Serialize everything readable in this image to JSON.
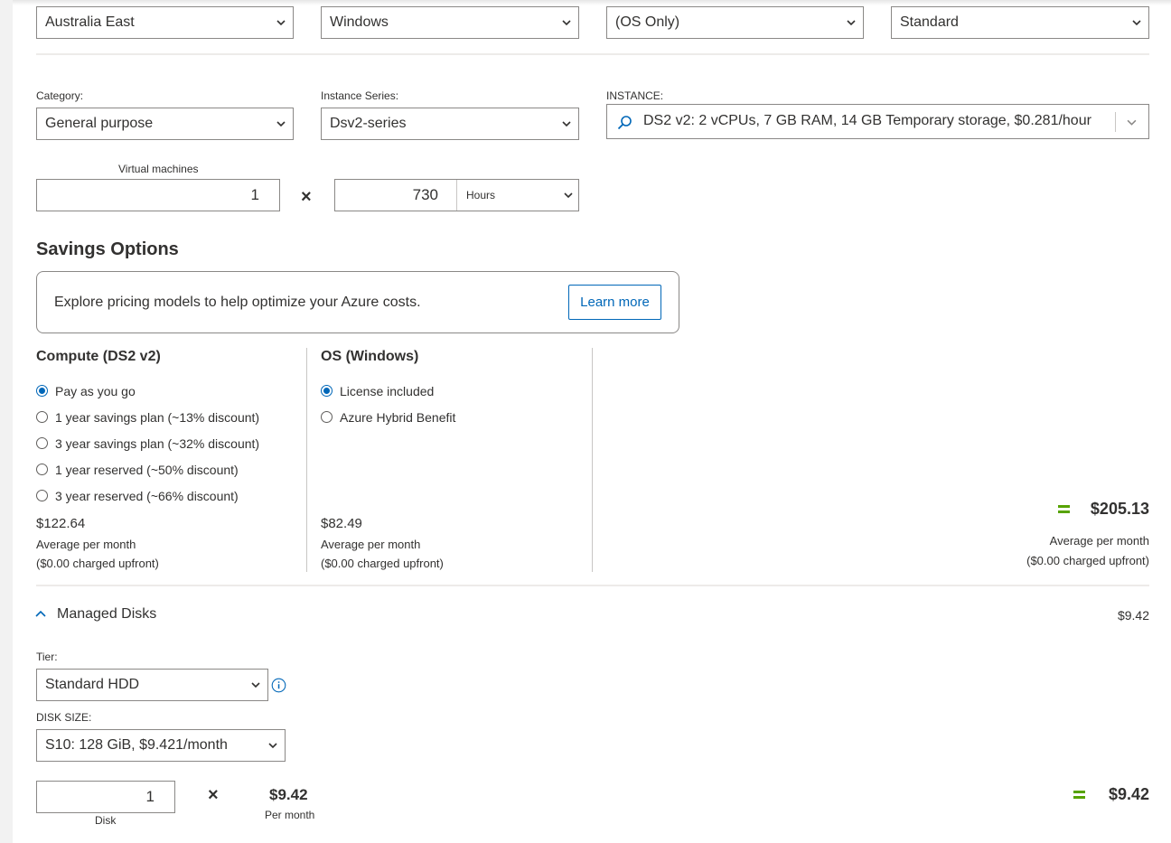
{
  "top_selects": {
    "region": "Australia East",
    "os": "Windows",
    "type": "(OS Only)",
    "tier": "Standard"
  },
  "instance_config": {
    "category_label": "Category:",
    "category_value": "General purpose",
    "series_label": "Instance Series:",
    "series_value": "Dsv2-series",
    "instance_label": "INSTANCE:",
    "instance_value": "DS2 v2: 2 vCPUs, 7 GB RAM, 14 GB Temporary storage, $0.281/hour",
    "vm_label": "Virtual machines",
    "vm_count": "1",
    "multiply": "×",
    "hours_value": "730",
    "hours_unit": "Hours"
  },
  "savings": {
    "title": "Savings Options",
    "banner_text": "Explore pricing models to help optimize your Azure costs.",
    "learn_more": "Learn more"
  },
  "compute": {
    "title": "Compute (DS2 v2)",
    "options": [
      "Pay as you go",
      "1 year savings plan (~13% discount)",
      "3 year savings plan (~32% discount)",
      "1 year reserved (~50% discount)",
      "3 year reserved (~66% discount)"
    ],
    "selected_index": 0,
    "price": "$122.64",
    "avg": "Average per month",
    "upfront": "($0.00 charged upfront)"
  },
  "os_section": {
    "title": "OS (Windows)",
    "options": [
      "License included",
      "Azure Hybrid Benefit"
    ],
    "selected_index": 0,
    "price": "$82.49",
    "avg": "Average per month",
    "upfront": "($0.00 charged upfront)"
  },
  "total": {
    "price": "$205.13",
    "avg": "Average per month",
    "upfront": "($0.00 charged upfront)"
  },
  "managed_disks": {
    "title": "Managed Disks",
    "header_price": "$9.42",
    "tier_label": "Tier:",
    "tier_value": "Standard HDD",
    "disk_size_label": "DISK SIZE:",
    "disk_size_value": "S10: 128 GiB, $9.421/month",
    "disk_count": "1",
    "disk_label": "Disk",
    "multiply": "×",
    "unit_price": "$9.42",
    "per_month": "Per month",
    "total_price": "$9.42"
  },
  "colors": {
    "accent_blue": "#0067b8",
    "equals_green": "#57a300",
    "border": "#8a8886"
  }
}
